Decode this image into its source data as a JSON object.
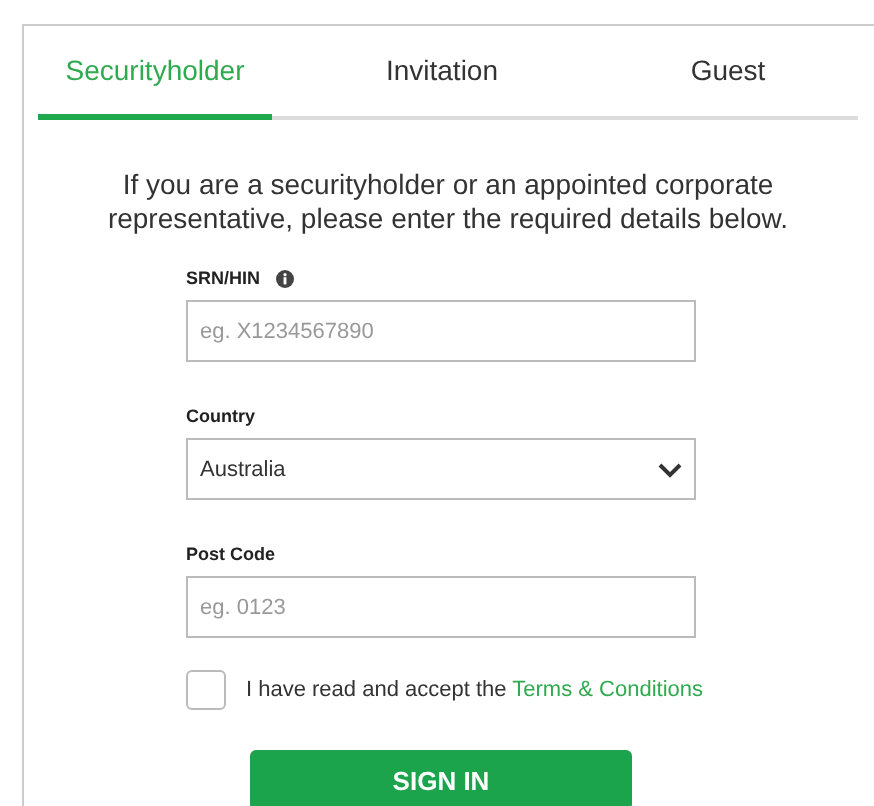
{
  "tabs": [
    {
      "label": "Securityholder",
      "selected": true
    },
    {
      "label": "Invitation",
      "selected": false
    },
    {
      "label": "Guest",
      "selected": false
    }
  ],
  "intro": "If you are a securityholder or an appointed corporate representative, please enter the required details below.",
  "fields": [
    {
      "kind": "text",
      "label": "SRN/HIN",
      "info": true,
      "placeholder": "eg. X1234567890"
    },
    {
      "kind": "select",
      "label": "Country",
      "value": "Australia"
    },
    {
      "kind": "text",
      "label": "Post Code",
      "placeholder": "eg. 0123"
    }
  ],
  "terms": {
    "checked": false,
    "text": "I have read and accept the",
    "link": "Terms & Conditions"
  },
  "button": "SIGN IN"
}
